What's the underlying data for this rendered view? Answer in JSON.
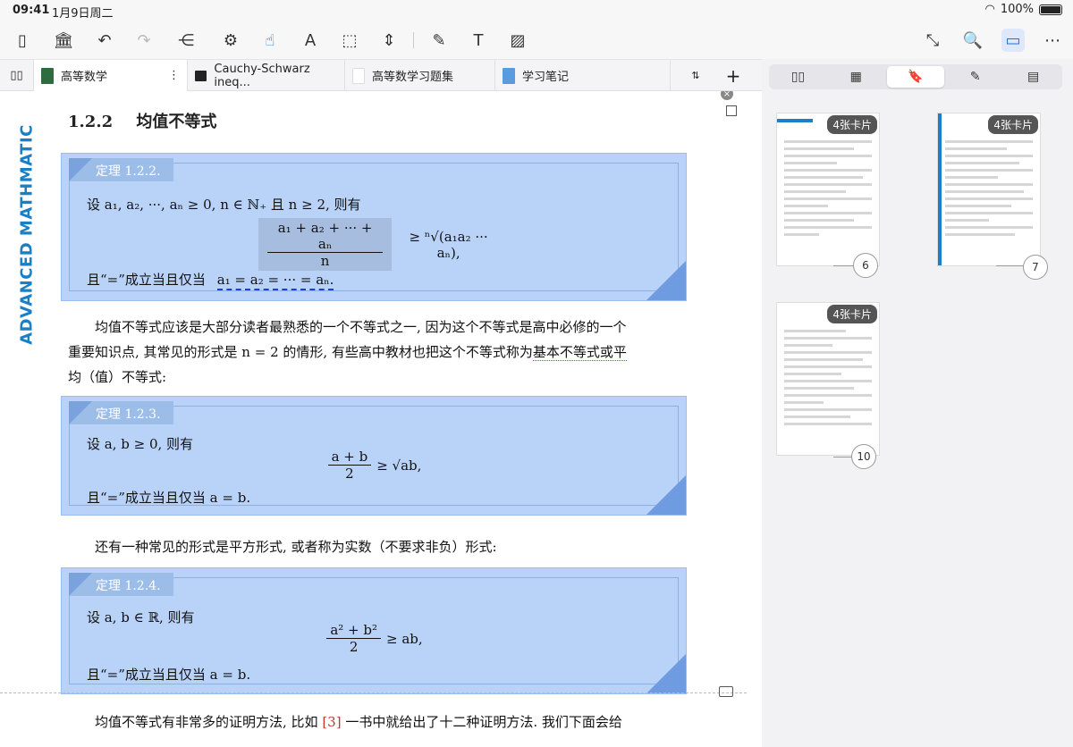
{
  "status": {
    "time": "09:41",
    "date": "1月9日周二",
    "battery": "100%"
  },
  "toolbar": {
    "icons": [
      "sidebar-icon",
      "library-icon",
      "undo-icon",
      "redo-icon",
      "share-icon",
      "settings-icon",
      "pointer-icon",
      "highlighter-icon",
      "rect-select-icon",
      "crop-icon",
      "pen-icon",
      "text-icon",
      "image-icon",
      "collapse-icon",
      "search-doc-icon",
      "bookmark-icon",
      "more-icon"
    ]
  },
  "tabs": [
    {
      "label": "高等数学",
      "color": "#2e6b3e"
    },
    {
      "label": "Cauchy-Schwarz ineq...",
      "color": "#222222"
    },
    {
      "label": "高等数学习题集",
      "color": "#ffffff"
    },
    {
      "label": "学习笔记",
      "color": "#5a9be0"
    }
  ],
  "doc": {
    "side_title": "ADVANCED MATHMATIC",
    "section_num": "1.2.2",
    "section_title": "均值不等式",
    "thm1": {
      "label": "定理 1.2.2.",
      "line1": "设 a₁, a₂, ···, aₙ ≥ 0, n ∈ ℕ₊ 且 n ≥ 2, 则有",
      "eq_num": "a₁ + a₂ + ··· + aₙ",
      "eq_den": "n",
      "eq_rhs": "≥ ⁿ√(a₁a₂ ··· aₙ),",
      "line3_prefix": "且“=”成立当且仅当",
      "line3_eq": "a₁ = a₂ = ··· = aₙ."
    },
    "para1": [
      "均值不等式应该是大部分读者最熟悉的一个不等式之一, 因为这个不等式是高中必修的一个",
      "重要知识点, 其常见的形式是 n = 2 的情形, 有些高中教材也把这个不等式称为",
      "基本不等式或平",
      "均（值）不等式:"
    ],
    "thm2": {
      "label": "定理 1.2.3.",
      "line1": "设 a, b ≥ 0, 则有",
      "eq_num": "a + b",
      "eq_den": "2",
      "eq_rhs": "≥ √ab,",
      "line3": "且“=”成立当且仅当 a = b."
    },
    "para2": "还有一种常见的形式是平方形式, 或者称为实数（不要求非负）形式:",
    "thm3": {
      "label": "定理 1.2.4.",
      "line1": "设 a, b ∈ ℝ, 则有",
      "eq_num": "a² + b²",
      "eq_den": "2",
      "eq_rhs": "≥ ab,",
      "line3": "且“=”成立当且仅当 a = b."
    },
    "para3_a": "均值不等式有非常多的证明方法, 比如 ",
    "para3_ref": "[3]",
    "para3_b": " 一书中就给出了十二种证明方法. 我们下面会给"
  },
  "panel": {
    "segments": [
      "▯▯",
      "▦",
      "🔖",
      "✎",
      "▤"
    ],
    "pages": [
      {
        "badge": "4张卡片",
        "num": "6"
      },
      {
        "badge": "4张卡片",
        "num": "7"
      },
      {
        "badge": "4张卡片",
        "num": "10"
      }
    ]
  }
}
